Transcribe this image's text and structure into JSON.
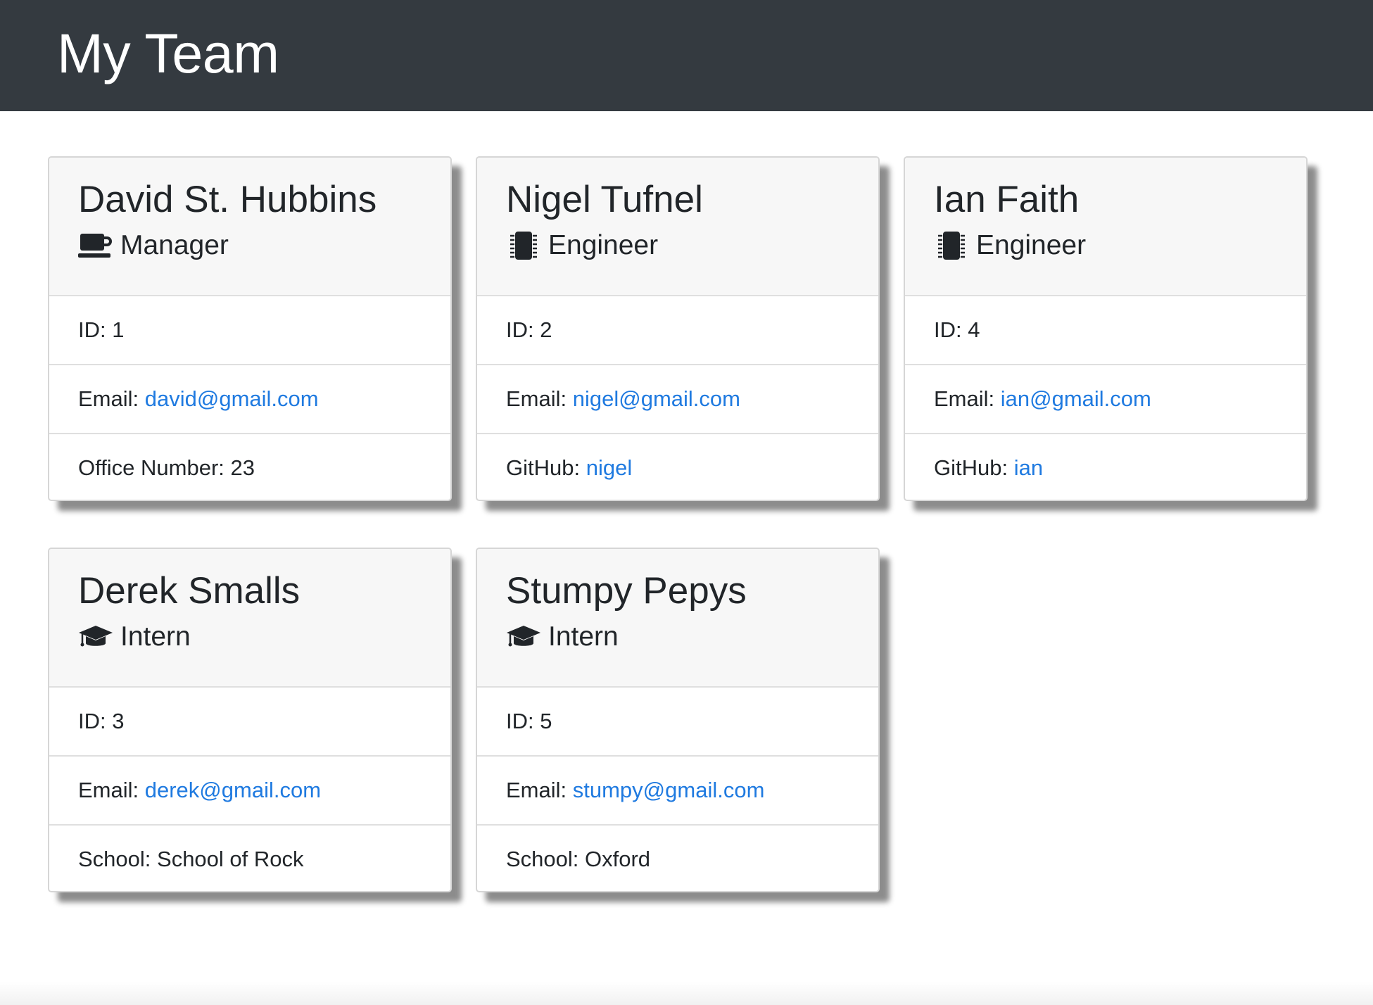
{
  "header": {
    "title": "My Team"
  },
  "cards": [
    {
      "name": "David St. Hubbins",
      "role": "Manager",
      "icon": "coffee-mug-icon",
      "id_label": "ID: ",
      "id": "1",
      "email_label": "Email: ",
      "email": "david@gmail.com",
      "extra_label": "Office Number: ",
      "extra_value": "23",
      "extra_is_link": false
    },
    {
      "name": "Nigel Tufnel",
      "role": "Engineer",
      "icon": "microchip-icon",
      "id_label": "ID: ",
      "id": "2",
      "email_label": "Email: ",
      "email": "nigel@gmail.com",
      "extra_label": "GitHub: ",
      "extra_value": "nigel",
      "extra_is_link": true
    },
    {
      "name": "Ian Faith",
      "role": "Engineer",
      "icon": "microchip-icon",
      "id_label": "ID: ",
      "id": "4",
      "email_label": "Email: ",
      "email": "ian@gmail.com",
      "extra_label": "GitHub: ",
      "extra_value": "ian",
      "extra_is_link": true
    },
    {
      "name": "Derek Smalls",
      "role": "Intern",
      "icon": "graduation-cap-icon",
      "id_label": "ID: ",
      "id": "3",
      "email_label": "Email: ",
      "email": "derek@gmail.com",
      "extra_label": "School: ",
      "extra_value": "School of Rock",
      "extra_is_link": false
    },
    {
      "name": "Stumpy Pepys",
      "role": "Intern",
      "icon": "graduation-cap-icon",
      "id_label": "ID: ",
      "id": "5",
      "email_label": "Email: ",
      "email": "stumpy@gmail.com",
      "extra_label": "School: ",
      "extra_value": "Oxford",
      "extra_is_link": false
    }
  ],
  "colors": {
    "navbar": "#343a40",
    "link": "#1f7ae0",
    "card_header": "#f7f7f7"
  }
}
